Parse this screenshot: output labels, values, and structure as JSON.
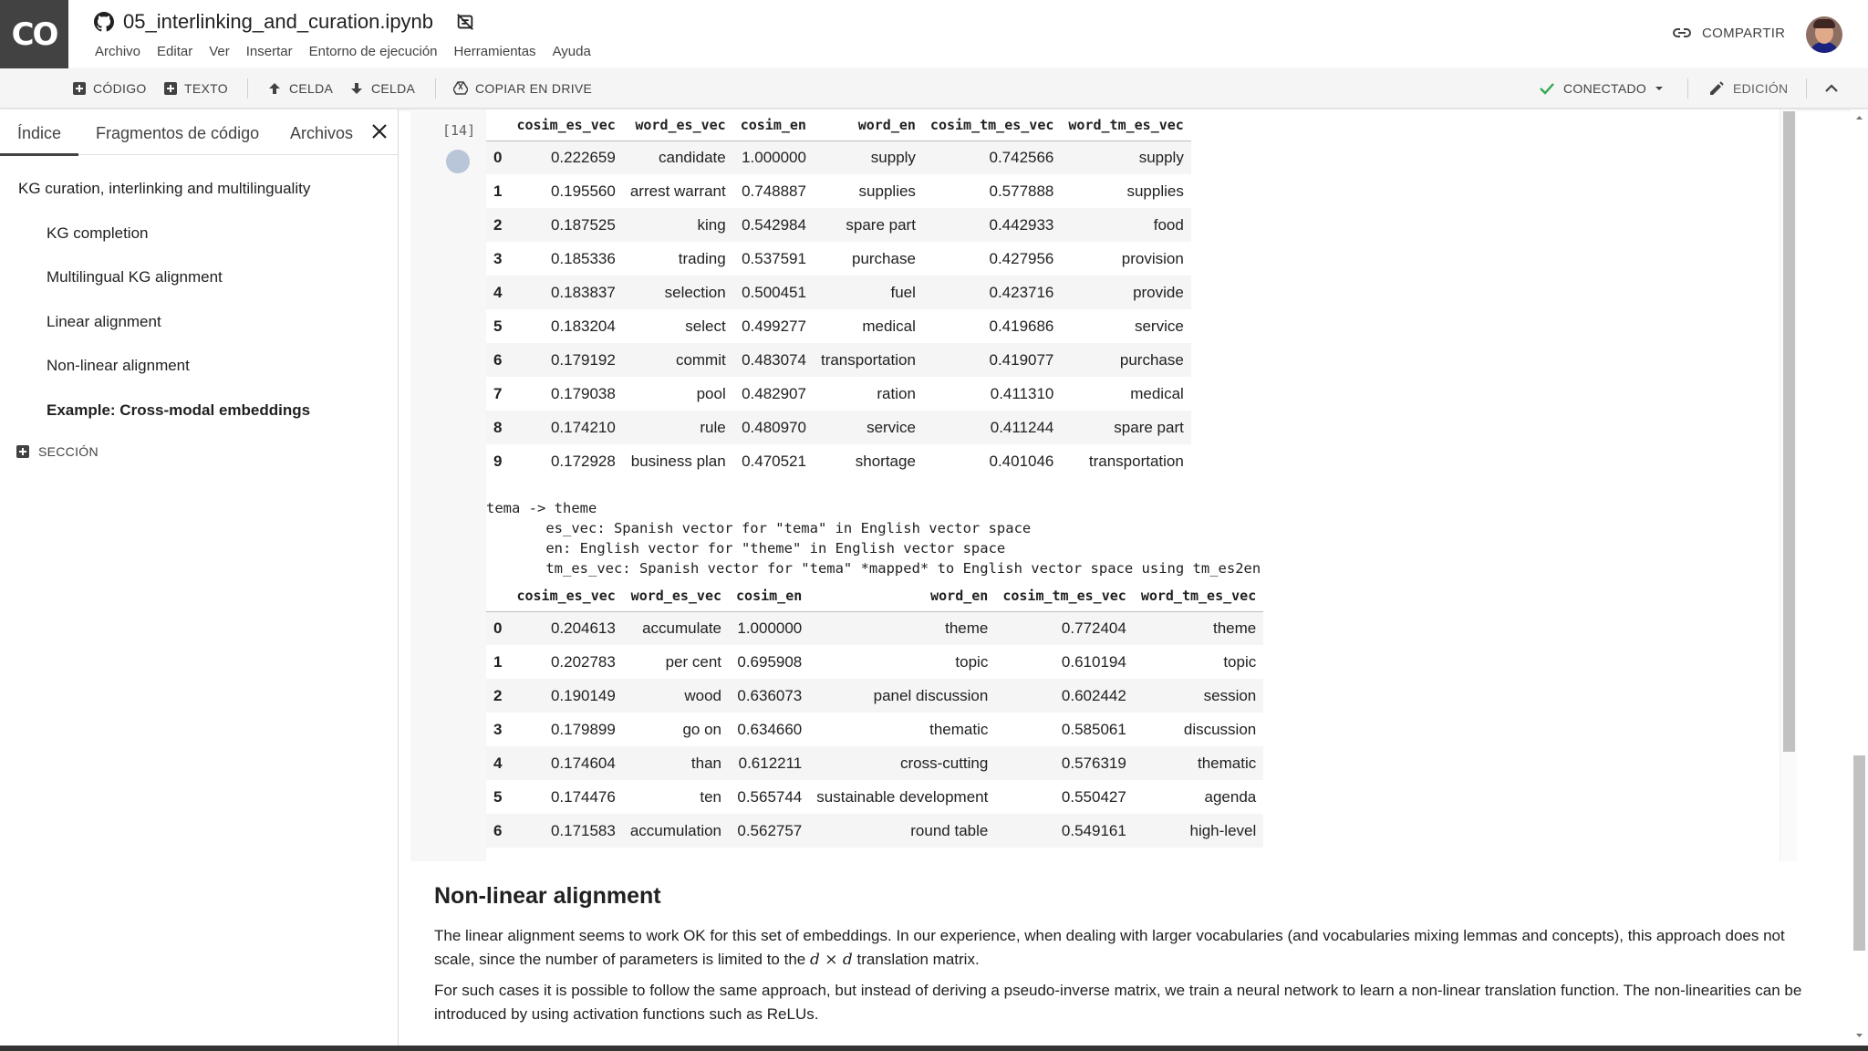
{
  "header": {
    "logo": "CO",
    "title": "05_interlinking_and_curation.ipynb",
    "menu": [
      "Archivo",
      "Editar",
      "Ver",
      "Insertar",
      "Entorno de ejecución",
      "Herramientas",
      "Ayuda"
    ],
    "share_label": "COMPARTIR"
  },
  "toolbar": {
    "code_label": "CÓDIGO",
    "text_label": "TEXTO",
    "cell_up_label": "CELDA",
    "cell_down_label": "CELDA",
    "copy_drive_label": "COPIAR EN DRIVE",
    "connected_label": "CONECTADO",
    "edit_label": "EDICIÓN"
  },
  "sidebar": {
    "tabs": [
      "Índice",
      "Fragmentos de código",
      "Archivos"
    ],
    "toc": [
      "KG curation, interlinking and multilinguality",
      "KG completion",
      "Multilingual KG alignment",
      "Linear alignment",
      "Non-linear alignment",
      "Example: Cross-modal embeddings"
    ],
    "add_section_label": "SECCIÓN"
  },
  "cell": {
    "execution_count": "[14]",
    "table1": {
      "columns": [
        "",
        "cosim_es_vec",
        "word_es_vec",
        "cosim_en",
        "word_en",
        "cosim_tm_es_vec",
        "word_tm_es_vec"
      ],
      "rows": [
        [
          "0",
          "0.222659",
          "candidate",
          "1.000000",
          "supply",
          "0.742566",
          "supply"
        ],
        [
          "1",
          "0.195560",
          "arrest warrant",
          "0.748887",
          "supplies",
          "0.577888",
          "supplies"
        ],
        [
          "2",
          "0.187525",
          "king",
          "0.542984",
          "spare part",
          "0.442933",
          "food"
        ],
        [
          "3",
          "0.185336",
          "trading",
          "0.537591",
          "purchase",
          "0.427956",
          "provision"
        ],
        [
          "4",
          "0.183837",
          "selection",
          "0.500451",
          "fuel",
          "0.423716",
          "provide"
        ],
        [
          "5",
          "0.183204",
          "select",
          "0.499277",
          "medical",
          "0.419686",
          "service"
        ],
        [
          "6",
          "0.179192",
          "commit",
          "0.483074",
          "transportation",
          "0.419077",
          "purchase"
        ],
        [
          "7",
          "0.179038",
          "pool",
          "0.482907",
          "ration",
          "0.411310",
          "medical"
        ],
        [
          "8",
          "0.174210",
          "rule",
          "0.480970",
          "service",
          "0.411244",
          "spare part"
        ],
        [
          "9",
          "0.172928",
          "business plan",
          "0.470521",
          "shortage",
          "0.401046",
          "transportation"
        ]
      ]
    },
    "stdout": "tema -> theme\n       es_vec: Spanish vector for \"tema\" in English vector space\n       en: English vector for \"theme\" in English vector space\n       tm_es_vec: Spanish vector for \"tema\" *mapped* to English vector space using tm_es2en",
    "table2": {
      "columns": [
        "",
        "cosim_es_vec",
        "word_es_vec",
        "cosim_en",
        "word_en",
        "cosim_tm_es_vec",
        "word_tm_es_vec"
      ],
      "rows": [
        [
          "0",
          "0.204613",
          "accumulate",
          "1.000000",
          "theme",
          "0.772404",
          "theme"
        ],
        [
          "1",
          "0.202783",
          "per cent",
          "0.695908",
          "topic",
          "0.610194",
          "topic"
        ],
        [
          "2",
          "0.190149",
          "wood",
          "0.636073",
          "panel discussion",
          "0.602442",
          "session"
        ],
        [
          "3",
          "0.179899",
          "go on",
          "0.634660",
          "thematic",
          "0.585061",
          "discussion"
        ],
        [
          "4",
          "0.174604",
          "than",
          "0.612211",
          "cross-cutting",
          "0.576319",
          "thematic"
        ],
        [
          "5",
          "0.174476",
          "ten",
          "0.565744",
          "sustainable development",
          "0.550427",
          "agenda"
        ],
        [
          "6",
          "0.171583",
          "accumulation",
          "0.562757",
          "round table",
          "0.549161",
          "high-level"
        ]
      ]
    }
  },
  "markdown": {
    "heading": "Non-linear alignment",
    "p1_a": "The linear alignment seems to work OK for this set of embeddings. In our experience, when dealing with larger vocabularies (and vocabularies mixing lemmas and concepts), this approach does not scale, since the number of parameters is limited to the ",
    "p1_math": "d × d",
    "p1_b": " translation matrix.",
    "p2": "For such cases it is possible to follow the same approach, but instead of deriving a pseudo-inverse matrix, we train a neural network to learn a non-linear translation function. The non-linearities can be introduced by using activation functions such as ReLUs."
  }
}
